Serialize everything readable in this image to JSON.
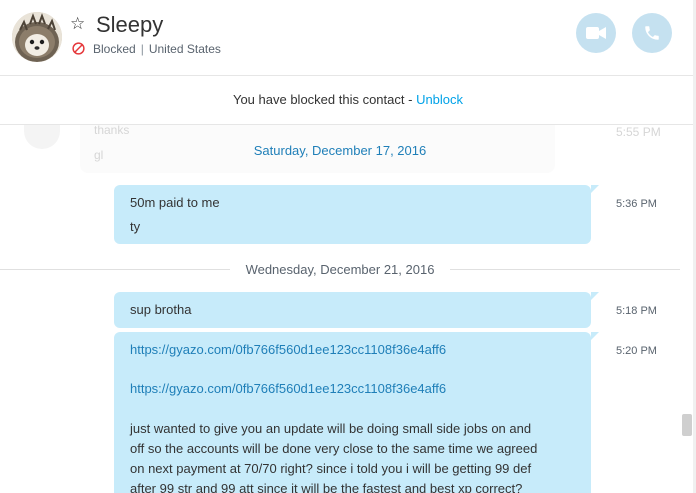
{
  "header": {
    "name": "Sleepy",
    "status": "Blocked",
    "location": "United States"
  },
  "notice": {
    "text": "You have blocked this contact - ",
    "action": "Unblock"
  },
  "ghost": {
    "line1": "thanks",
    "line2": "gl",
    "time": "5:55 PM"
  },
  "days": [
    {
      "date": "Saturday, December 17, 2016",
      "messages": [
        {
          "lines": [
            "50m paid to me",
            "ty"
          ],
          "time": "5:36 PM"
        }
      ]
    },
    {
      "date": "Wednesday, December 21, 2016",
      "messages": [
        {
          "lines": [
            "sup brotha"
          ],
          "time": "5:18 PM"
        },
        {
          "lines": [
            "https://gyazo.com/0fb766f560d1ee123cc1108f36e4aff6",
            "https://gyazo.com/0fb766f560d1ee123cc1108f36e4aff6",
            "just wanted to give you an update will be doing small side jobs on and",
            "off so the accounts will be done very close to the same time we agreed",
            "on next payment at 70/70 right? since i told you i will be getting 99 def",
            "after 99 str and 99 att since it will be the fastest and best xp correct?"
          ],
          "time": "5:20 PM"
        }
      ]
    }
  ],
  "colors": {
    "bubble": "#c7ebfa",
    "link": "#1f7fb8",
    "blocked": "#e5383b",
    "call_button": "#c5e1f0"
  },
  "icons": {
    "favorite": "star-outline-icon",
    "blocked": "blocked-icon",
    "video": "video-camera-icon",
    "call": "phone-icon"
  }
}
